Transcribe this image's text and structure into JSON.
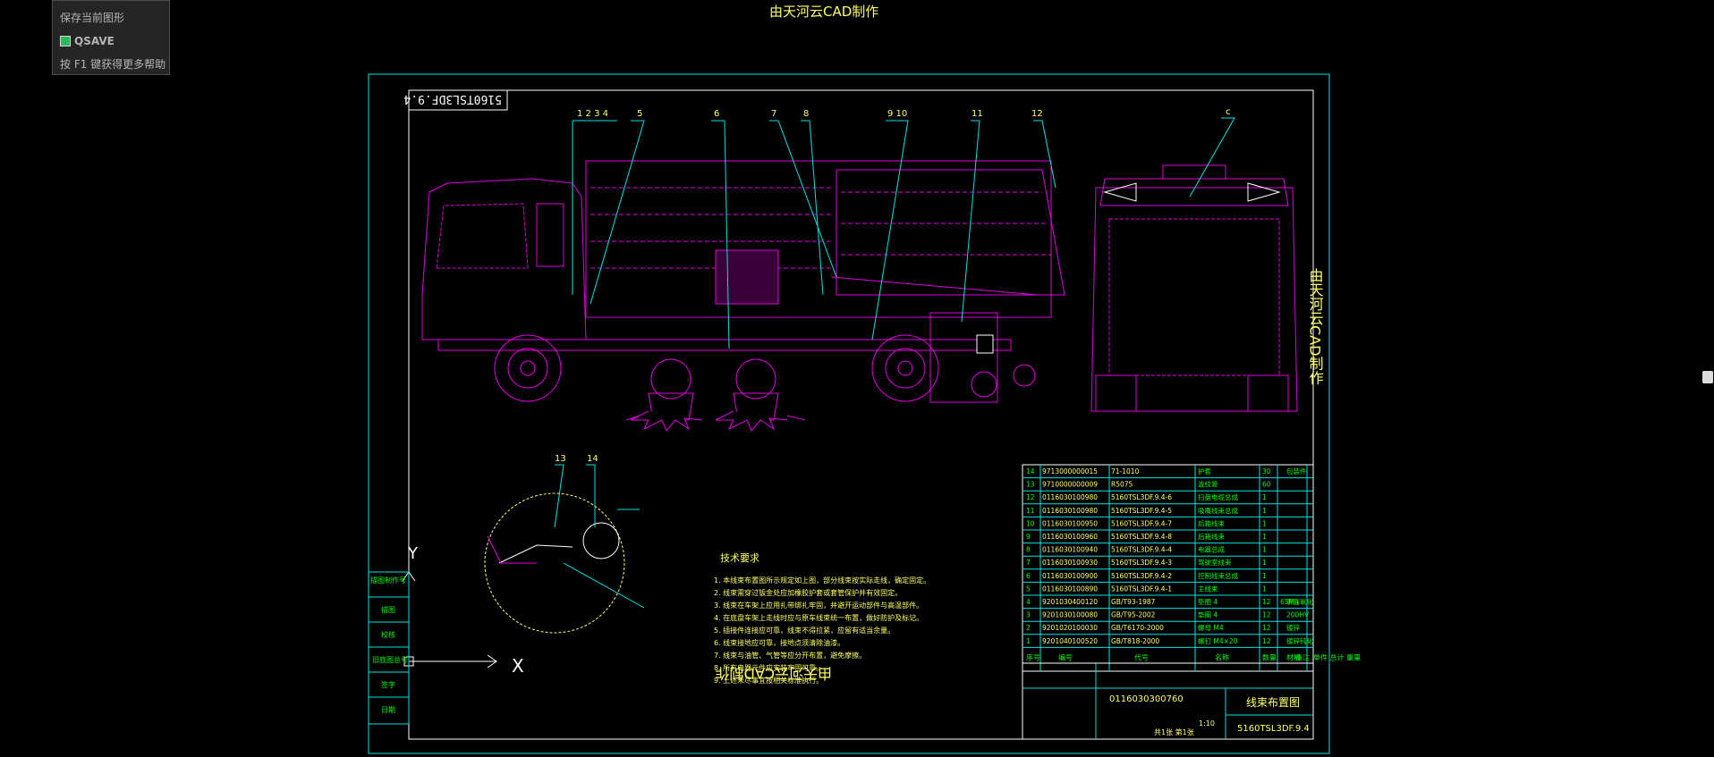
{
  "app": {
    "top_title": "由天河云CAD制作"
  },
  "tooltip": {
    "line1": "保存当前图形",
    "command": "QSAVE",
    "help": "按 F1 键获得更多帮助"
  },
  "drawing": {
    "code_stamp": "5160TSL3DF.9.4",
    "watermark_side": "由天河云CAD制作",
    "watermark_bottom": "由天河云CAD制作",
    "balloons_top": [
      "1 2 3 4",
      "5",
      "6",
      "7",
      "8",
      "9 10",
      "11",
      "12"
    ],
    "balloons_detail": [
      "13",
      "14"
    ],
    "balloon_end": "c",
    "axis_y": "Y",
    "axis_x": "X",
    "left_cells": [
      "描图制作号",
      "描图",
      "校核",
      "旧底图总号",
      "签字",
      "日期"
    ],
    "tech_title": "技术要求",
    "tech_lines": [
      "1. 本线束布置图所示规定如上图，部分线束按实际走线，确定固定。",
      "2. 线束需穿过钣金处应加橡胶护套或套管保护并有效固定。",
      "3. 线束在车架上应用扎带绑扎牢固，并避开运动部件与高温部件。",
      "4. 在底盘车架上走线时应与原车线束统一布置，做好防护及标记。",
      "5. 插接件连接应可靠，线束不得拉紧，应留有适当余量。",
      "6. 线束接地应可靠，接地点须清除油漆。",
      "7. 线束与油管、气管等应分开布置，避免摩擦。",
      "8. 所有电器元件应安装牢固可靠。",
      "9. 上述未尽事宜按相关标准执行。"
    ]
  },
  "bom": {
    "rows": [
      [
        "14",
        "9713000000015",
        "71-1010",
        "护套",
        "30",
        "",
        "",
        "包装件"
      ],
      [
        "13",
        "9710000000009",
        "R5075",
        "波纹管",
        "60",
        "",
        "",
        "",
        ""
      ],
      [
        "12",
        "0116030100980",
        "5160TSL3DF.9.4-6",
        "扫盘电缆总成",
        "1",
        "",
        "",
        ""
      ],
      [
        "11",
        "0116030100980",
        "5160TSL3DF.9.4-5",
        "吸嘴线束总成",
        "1",
        "",
        "",
        ""
      ],
      [
        "10",
        "0116030100950",
        "5160TSL3DF.9.4-7",
        "后箱线束",
        "1",
        "",
        "",
        ""
      ],
      [
        "9",
        "0116030100960",
        "5160TSL3DF.9.4-8",
        "后箱线束",
        "1",
        "",
        "",
        ""
      ],
      [
        "8",
        "0116030100940",
        "5160TSL3DF.9.4-4",
        "电器总成",
        "1",
        "",
        "",
        ""
      ],
      [
        "7",
        "0116030100930",
        "5160TSL3DF.9.4-3",
        "驾驶室线束",
        "1",
        "",
        "",
        ""
      ],
      [
        "6",
        "0116030100900",
        "5160TSL3DF.9.4-2",
        "控制线束总成",
        "1",
        "",
        "",
        ""
      ],
      [
        "5",
        "0116030100890",
        "5160TSL3DF.9.4-1",
        "主线束",
        "1",
        "",
        "",
        ""
      ],
      [
        "4",
        "9201030400120",
        "GB/T93-1987",
        "垫圈 4",
        "12",
        "65Mn",
        "",
        "表面氧化"
      ],
      [
        "3",
        "9201030100080",
        "GB/T95-2002",
        "垫圈 4",
        "12",
        "",
        "",
        "200HV"
      ],
      [
        "2",
        "9201020100030",
        "GB/T6170-2000",
        "螺母 M4",
        "12",
        "",
        "",
        "镀锌"
      ],
      [
        "1",
        "9201040100520",
        "GB/T818-2000",
        "螺钉 M4×20",
        "12",
        "",
        "",
        "镀锌钝化"
      ]
    ],
    "header": [
      "序号",
      "编号",
      "代号",
      "名称",
      "数量",
      "材料",
      "单件 总计 重量",
      "备注"
    ],
    "drawing_no": "0116030300760",
    "title": "线束布置图",
    "code": "5160TSL3DF.9.4",
    "scale": "1:10",
    "sheet": "共1张 第1张"
  },
  "colors": {
    "frame": "#00e5e5",
    "truck": "#e000e0",
    "accent": "#ffff66",
    "text": "#00ff00",
    "white": "#ffffff"
  }
}
